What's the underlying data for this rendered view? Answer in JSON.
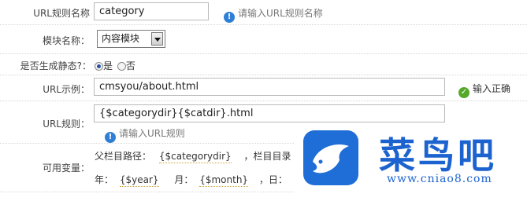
{
  "form": {
    "url_rule_name": {
      "label": "URL规则名称",
      "value": "category",
      "hint": "请输入URL规则名称"
    },
    "module_name": {
      "label": "模块名称：",
      "selected": "内容模块"
    },
    "generate_static": {
      "label": "是否生成静态?：",
      "options": [
        "是",
        "否"
      ],
      "selected": "是"
    },
    "url_example": {
      "label": "URL示例：",
      "value": "cmsyou/about.html",
      "hint": "输入正确"
    },
    "url_rule": {
      "label": "URL规则：",
      "value": "{$categorydir}{$catdir}.html",
      "hint": "请输入URL规则"
    },
    "available_vars": {
      "label": "可用变量：",
      "line1": {
        "prefix": "父栏目路径：",
        "var1": "{$categorydir}",
        "suffix": "，栏目目录"
      },
      "line2": {
        "year_label": "年：",
        "year_var": "{$year}",
        "month_label": "月：",
        "month_var": "{$month}",
        "day_label": "，日：",
        "day_var": "{"
      }
    }
  },
  "watermark": {
    "brand": "菜鸟吧",
    "url": "www.cniao8.com"
  },
  "colors": {
    "info_icon": "#2f7fd7",
    "ok_icon": "#55a82a",
    "brand": "#1c63cf"
  }
}
